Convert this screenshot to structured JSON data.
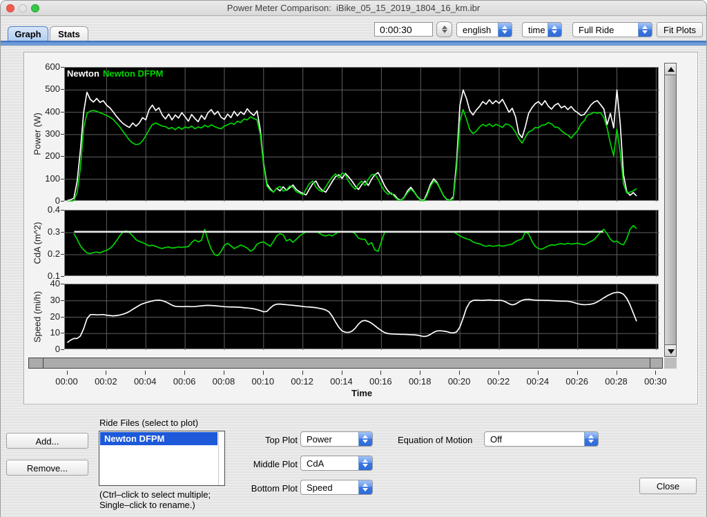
{
  "window": {
    "title": "Power Meter Comparison:  iBike_05_15_2019_1804_16_km.ibr"
  },
  "tabs": {
    "graph": "Graph",
    "stats": "Stats"
  },
  "toolbar": {
    "time_value": "0:00:30",
    "units_dropdown": "english",
    "xaxis_dropdown": "time",
    "range_dropdown": "Full Ride",
    "fit_plots_label": "Fit Plots"
  },
  "bottom": {
    "add_label": "Add...",
    "remove_label": "Remove...",
    "ride_files_label": "Ride Files (select to plot)",
    "ride_files": [
      "Newton DFPM"
    ],
    "hint_line1": "(Ctrl–click to select multiple;",
    "hint_line2": "Single–click to rename.)",
    "top_plot_label": "Top Plot",
    "top_plot_value": "Power",
    "middle_plot_label": "Middle Plot",
    "middle_plot_value": "CdA",
    "bottom_plot_label": "Bottom Plot",
    "bottom_plot_value": "Speed",
    "eom_label": "Equation of Motion",
    "eom_value": "Off",
    "close_label": "Close"
  },
  "chart_data": {
    "type": "line",
    "x": {
      "label": "Time",
      "dt_min": 0.16667,
      "xlim": [
        0,
        30
      ],
      "tick_minutes": [
        0,
        2,
        4,
        6,
        8,
        10,
        12,
        14,
        16,
        18,
        20,
        22,
        24,
        26,
        28,
        30
      ],
      "tick_labels": [
        "00:00",
        "00:02",
        "00:04",
        "00:06",
        "00:08",
        "00:10",
        "00:12",
        "00:14",
        "00:16",
        "00:18",
        "00:20",
        "00:22",
        "00:24",
        "00:26",
        "00:28",
        "00:30"
      ],
      "grid_minutes": [
        2,
        4,
        6,
        8,
        10,
        12,
        14,
        16,
        18,
        20,
        22,
        24,
        26,
        28,
        30
      ]
    },
    "plots": [
      {
        "id": "power",
        "ylabel": "Power (W)",
        "ylim": [
          0,
          600
        ],
        "yticks": [
          600,
          500,
          400,
          300,
          200,
          100,
          0
        ],
        "grid_values": [
          100,
          200,
          300,
          400,
          500
        ],
        "legend": true,
        "series": [
          {
            "name": "Newton",
            "color": "#ffffff",
            "values": [
              5,
              8,
              15,
              90,
              230,
              400,
              490,
              458,
              446,
              462,
              444,
              452,
              432,
              420,
              402,
              382,
              365,
              350,
              340,
              332,
              352,
              338,
              352,
              376,
              366,
              412,
              432,
              408,
              420,
              388,
              370,
              392,
              366,
              388,
              374,
              398,
              380,
              360,
              390,
              372,
              358,
              386,
              368,
              398,
              412,
              390,
              404,
              378,
              368,
              392,
              376,
              404,
              384,
              402,
              390,
              416,
              398,
              386,
              406,
              320,
              170,
              80,
              58,
              42,
              60,
              48,
              66,
              50,
              62,
              74,
              54,
              44,
              36,
              30,
              56,
              80,
              92,
              64,
              50,
              42,
              66,
              90,
              112,
              120,
              104,
              126,
              110,
              92,
              70,
              54,
              76,
              92,
              72,
              100,
              120,
              130,
              102,
              70,
              48,
              34,
              30,
              12,
              6,
              20,
              48,
              64,
              44,
              22,
              8,
              6,
              38,
              78,
              102,
              86,
              56,
              26,
              10,
              6,
              22,
              180,
              430,
              500,
              462,
              408,
              388,
              410,
              426,
              448,
              436,
              456,
              438,
              452,
              440,
              458,
              430,
              400,
              418,
              380,
              305,
              286,
              335,
              395,
              420,
              438,
              448,
              432,
              452,
              428,
              414,
              432,
              440,
              420,
              428,
              412,
              426,
              408,
              398,
              386,
              390,
              410,
              432,
              446,
              452,
              434,
              415,
              345,
              395,
              330,
              500,
              350,
              120,
              45,
              28,
              40,
              25
            ]
          },
          {
            "name": "Newton DFPM",
            "color": "#00d600",
            "values": [
              0,
              0,
              5,
              40,
              150,
              330,
              395,
              405,
              408,
              404,
              398,
              392,
              386,
              378,
              368,
              352,
              335,
              315,
              295,
              275,
              262,
              255,
              258,
              272,
              295,
              322,
              345,
              352,
              345,
              338,
              336,
              326,
              332,
              322,
              334,
              324,
              334,
              330,
              338,
              326,
              334,
              330,
              342,
              334,
              344,
              336,
              330,
              326,
              338,
              344,
              352,
              346,
              360,
              354,
              370,
              366,
              380,
              372,
              366,
              300,
              160,
              70,
              52,
              42,
              60,
              68,
              47,
              52,
              70,
              64,
              44,
              38,
              30,
              56,
              80,
              92,
              65,
              50,
              44,
              66,
              90,
              110,
              124,
              106,
              128,
              120,
              90,
              70,
              55,
              78,
              92,
              72,
              100,
              120,
              122,
              100,
              70,
              46,
              32,
              40,
              22,
              8,
              5,
              18,
              40,
              56,
              42,
              20,
              6,
              3,
              28,
              68,
              92,
              82,
              55,
              25,
              8,
              5,
              15,
              150,
              360,
              412,
              370,
              322,
              305,
              315,
              334,
              346,
              338,
              348,
              336,
              346,
              340,
              332,
              348,
              344,
              332,
              310,
              282,
              262,
              288,
              312,
              318,
              332,
              330,
              342,
              344,
              354,
              348,
              334,
              332,
              318,
              306,
              298,
              284,
              302,
              318,
              348,
              362,
              388,
              392,
              400,
              396,
              398,
              376,
              330,
              260,
              205,
              325,
              220,
              80,
              38,
              42,
              48,
              58
            ]
          }
        ]
      },
      {
        "id": "cda",
        "ylabel": "CdA (m^2)",
        "ylim": [
          0.1,
          0.4
        ],
        "yticks": [
          0.4,
          0.3,
          0.2,
          0.1
        ],
        "grid_values": [
          0.2,
          0.3
        ],
        "series": [
          {
            "name": "Newton DFPM",
            "color": "#00d600",
            "values": [
              null,
              null,
              0.295,
              0.27,
              0.24,
              0.222,
              0.208,
              0.205,
              0.21,
              0.212,
              0.208,
              0.215,
              0.22,
              0.228,
              0.242,
              0.262,
              0.285,
              0.302,
              0.308,
              0.3,
              0.285,
              0.268,
              0.26,
              0.255,
              0.248,
              0.24,
              0.243,
              0.238,
              0.232,
              0.228,
              0.233,
              0.235,
              0.23,
              0.232,
              0.235,
              0.233,
              0.235,
              0.237,
              0.255,
              0.267,
              0.258,
              0.265,
              0.315,
              0.265,
              0.225,
              0.2,
              0.196,
              0.215,
              0.242,
              0.252,
              0.24,
              0.228,
              0.235,
              0.244,
              0.238,
              0.23,
              0.216,
              0.225,
              0.248,
              0.255,
              0.258,
              0.248,
              0.238,
              0.26,
              0.285,
              0.295,
              0.29,
              0.262,
              0.27,
              0.256,
              0.27,
              0.285,
              0.295,
              0.303,
              0.304,
              0.304,
              0.304,
              0.298,
              0.288,
              0.285,
              0.29,
              0.285,
              0.295,
              0.304,
              0.304,
              0.304,
              0.304,
              0.304,
              0.295,
              0.275,
              0.27,
              0.27,
              0.245,
              0.255,
              0.222,
              0.215,
              0.26,
              0.302,
              0.304,
              0.304,
              0.304,
              0.304,
              0.304,
              0.304,
              0.304,
              0.304,
              0.304,
              0.304,
              0.304,
              0.304,
              0.304,
              0.304,
              0.304,
              0.304,
              0.304,
              0.304,
              0.304,
              0.304,
              0.304,
              0.295,
              0.285,
              0.278,
              0.272,
              0.268,
              0.258,
              0.252,
              0.25,
              0.242,
              0.238,
              0.242,
              0.238,
              0.24,
              0.243,
              0.238,
              0.242,
              0.245,
              0.248,
              0.26,
              0.266,
              0.272,
              0.302,
              0.295,
              0.262,
              0.238,
              0.228,
              0.225,
              0.232,
              0.24,
              0.245,
              0.243,
              0.248,
              0.25,
              0.247,
              0.252,
              0.248,
              0.25,
              0.252,
              0.248,
              0.245,
              0.252,
              0.26,
              0.268,
              0.285,
              0.302,
              0.315,
              0.295,
              0.27,
              0.258,
              0.262,
              0.25,
              0.245,
              0.272,
              0.315,
              0.332,
              0.318
            ]
          },
          {
            "name": "Newton",
            "color": "#efefef",
            "points": [
              [
                0.35,
                0.304
              ],
              [
                27.3,
                0.304
              ]
            ]
          }
        ]
      },
      {
        "id": "speed",
        "ylabel": "Speed (mi/h)",
        "ylim": [
          0,
          40
        ],
        "yticks": [
          40,
          30,
          20,
          10,
          0
        ],
        "grid_values": [
          10,
          20,
          30
        ],
        "series": [
          {
            "name": "Newton",
            "color": "#ffffff",
            "values": [
              4.5,
              6,
              7,
              7,
              8.5,
              13,
              19,
              21.5,
              21.6,
              21.4,
              21.5,
              21.6,
              21.2,
              21,
              20.8,
              21,
              21.3,
              21.8,
              22.5,
              23.5,
              24.8,
              26,
              27.2,
              28.2,
              28.8,
              29.4,
              29.9,
              30.3,
              30.4,
              30.1,
              29.4,
              28.4,
              27.3,
              26.6,
              26.5,
              26.4,
              26.5,
              26.5,
              26.4,
              26.5,
              26.7,
              26.9,
              27.1,
              27.2,
              27.1,
              27,
              26.8,
              26.6,
              26.4,
              26.3,
              26.2,
              26.2,
              26.1,
              26,
              25.8,
              25.6,
              25.4,
              25.1,
              24.6,
              24,
              23.3,
              23.5,
              25.5,
              27.2,
              27.9,
              28,
              27.8,
              27.6,
              27.4,
              27.2,
              27,
              26.8,
              26.5,
              26.3,
              26.2,
              26,
              25.8,
              25.4,
              25,
              24.4,
              23.2,
              20.5,
              17,
              13.8,
              11.6,
              10.8,
              10.7,
              11.4,
              13.2,
              15.8,
              17.6,
              18,
              17.4,
              16.3,
              14.8,
              13.2,
              11.8,
              10.6,
              10,
              9.8,
              9.7,
              9.6,
              9.5,
              9.5,
              9.4,
              9.3,
              9.2,
              9,
              8.6,
              8.2,
              8.5,
              9.5,
              10.8,
              11.6,
              11.7,
              11.5,
              11.2,
              10.6,
              10.4,
              11,
              14,
              19.5,
              25.5,
              29,
              30.2,
              30.4,
              30.3,
              30.2,
              30.4,
              30.5,
              30.3,
              30.2,
              30.3,
              30.1,
              29.3,
              28.2,
              27.5,
              28,
              29.2,
              30.3,
              30.8,
              30.9,
              30.6,
              30.4,
              30.3,
              30.3,
              30.2,
              30.2,
              30.1,
              30,
              29.9,
              29.8,
              29.8,
              29.7,
              29.4,
              28.8,
              28.2,
              27.8,
              27.6,
              27.7,
              27.9,
              28.4,
              29.3,
              30.5,
              31.8,
              33,
              34,
              34.8,
              35.2,
              35,
              34,
              31.5,
              27.5,
              22.5,
              17.5
            ]
          }
        ]
      }
    ]
  }
}
